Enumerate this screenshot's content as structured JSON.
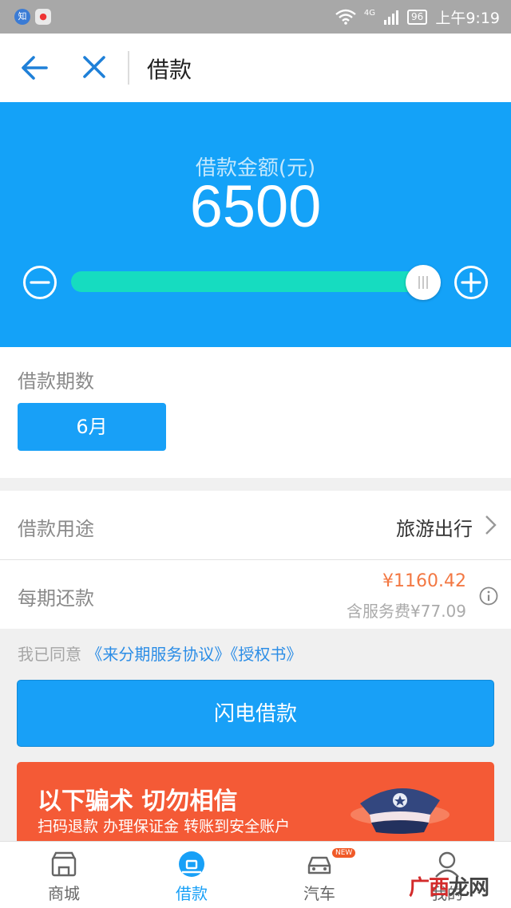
{
  "status_bar": {
    "app_icon_1": "知",
    "network": "4G",
    "battery": "96",
    "time": "上午9:19"
  },
  "nav": {
    "title": "借款",
    "back_icon": "arrow-left-icon",
    "close_icon": "close-icon"
  },
  "loan": {
    "amount_label": "借款金额(元)",
    "amount": "6500",
    "slider_level": 1.0
  },
  "period": {
    "label": "借款期数",
    "selected": "6月"
  },
  "purpose": {
    "label": "借款用途",
    "value": "旅游出行"
  },
  "repayment": {
    "label": "每期还款",
    "amount": "¥1160.42",
    "fee": "含服务费¥77.09"
  },
  "agreement": {
    "prefix": "我已同意",
    "service_link": "《来分期服务协议》",
    "auth_link": "《授权书》"
  },
  "submit_label": "闪电借款",
  "banner": {
    "title": "以下骗术 切勿相信",
    "subtitle": "扫码退款 办理保证金 转账到安全账户"
  },
  "tabs": [
    {
      "label": "商城",
      "icon": "shop-icon"
    },
    {
      "label": "借款",
      "icon": "loan-icon"
    },
    {
      "label": "汽车",
      "icon": "car-icon",
      "badge": "NEW"
    },
    {
      "label": "我的",
      "icon": "profile-icon"
    }
  ],
  "watermark": {
    "a": "广西",
    "b": "龙网"
  },
  "colors": {
    "primary": "#14a2f8",
    "slider": "#16dcc0",
    "price": "#f37843",
    "banner": "#f45a36"
  }
}
